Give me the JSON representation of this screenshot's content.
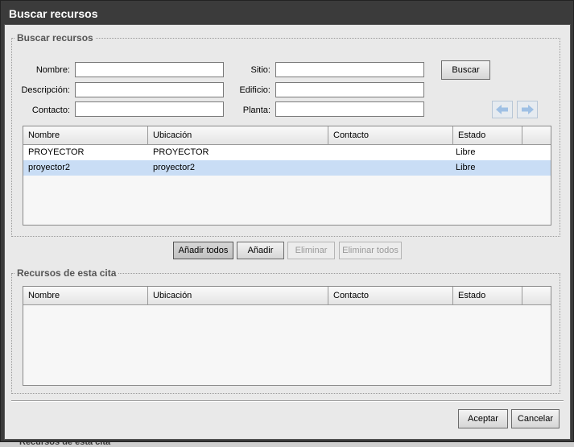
{
  "dialog": {
    "title": "Buscar recursos"
  },
  "search": {
    "legend": "Buscar recursos",
    "fields": {
      "nombre": {
        "label": "Nombre:",
        "value": ""
      },
      "descripcion": {
        "label": "Descripción:",
        "value": ""
      },
      "contacto": {
        "label": "Contacto:",
        "value": ""
      },
      "sitio": {
        "label": "Sitio:",
        "value": ""
      },
      "edificio": {
        "label": "Edificio:",
        "value": ""
      },
      "planta": {
        "label": "Planta:",
        "value": ""
      }
    },
    "search_button": "Buscar",
    "prev_icon": "arrow-left-icon",
    "next_icon": "arrow-right-icon",
    "results": {
      "columns": [
        "Nombre",
        "Ubicación",
        "Contacto",
        "Estado"
      ],
      "rows": [
        {
          "nombre": "PROYECTOR",
          "ubicacion": "PROYECTOR",
          "contacto": "",
          "estado": "Libre",
          "selected": false
        },
        {
          "nombre": "proyector2",
          "ubicacion": "proyector2",
          "contacto": "",
          "estado": "Libre",
          "selected": true
        }
      ]
    }
  },
  "actions": {
    "add_all": "Añadir todos",
    "add": "Añadir",
    "remove": "Eliminar",
    "remove_all": "Eliminar todos"
  },
  "appointment": {
    "legend": "Recursos de esta cita",
    "columns": [
      "Nombre",
      "Ubicación",
      "Contacto",
      "Estado"
    ]
  },
  "footer": {
    "accept": "Aceptar",
    "cancel": "Cancelar"
  },
  "background_text": "Recursos de esta cita",
  "colors": {
    "titlebar": "#3b3b3b",
    "selected_row": "#c9ddf5",
    "panel": "#e9e9e9"
  }
}
